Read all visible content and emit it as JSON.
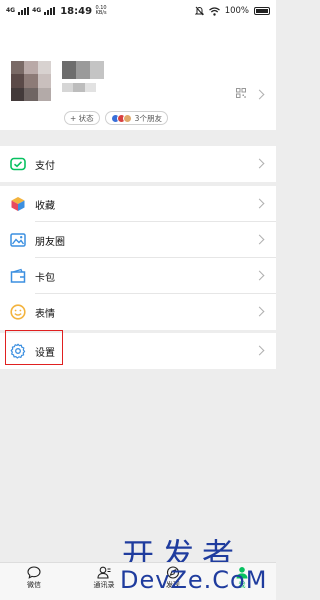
{
  "status_bar": {
    "signal_1": "4G",
    "signal_2": "4G",
    "time": "18:49",
    "speed": "0.10 KB/s",
    "battery": "100%"
  },
  "profile": {
    "status_chip": "+ 状态",
    "friends_chip": "3个朋友",
    "colors": {
      "dot1": "#3a6fd8",
      "dot2": "#d84040",
      "dot3": "#e0a86a"
    }
  },
  "menu": {
    "pay": "支付",
    "favorites": "收藏",
    "moments": "朋友圈",
    "cards": "卡包",
    "stickers": "表情",
    "settings": "设置"
  },
  "tabs": {
    "chats": "微信",
    "contacts": "通讯录",
    "discover": "发现",
    "me": "我"
  },
  "watermark": {
    "line1": "开发者",
    "line2": "DevZe.CoM"
  },
  "colors": {
    "accent": "#07c160",
    "highlight": "#e02020",
    "watermark": "#1f3c9e"
  }
}
